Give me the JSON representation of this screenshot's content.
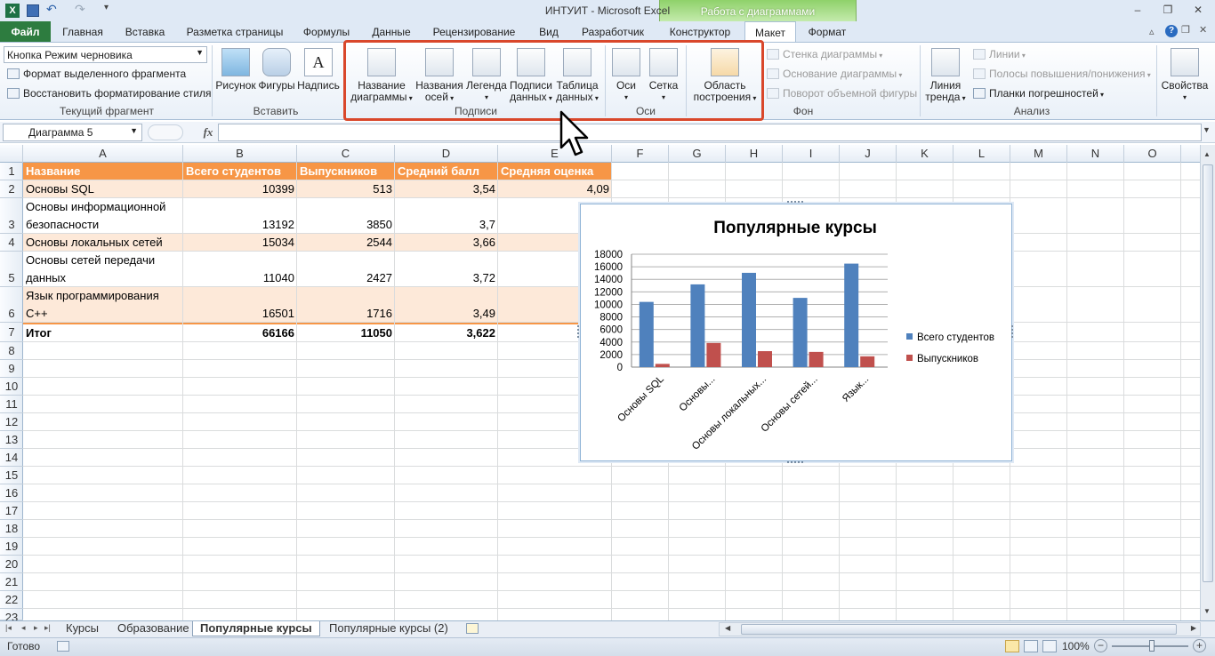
{
  "window": {
    "title": "ИНТУИТ - Microsoft Excel",
    "context_group": "Работа с диаграммами"
  },
  "tabs": [
    "Файл",
    "Главная",
    "Вставка",
    "Разметка страницы",
    "Формулы",
    "Данные",
    "Рецензирование",
    "Вид",
    "Разработчик",
    "Конструктор",
    "Макет",
    "Формат"
  ],
  "ribbon": {
    "current_fragment": {
      "dropdown_value": "Кнопка Режим черновика",
      "format_selection": "Формат выделенного фрагмента",
      "reset_style": "Восстановить форматирование стиля",
      "label": "Текущий фрагмент"
    },
    "insert": {
      "picture": "Рисунок",
      "shapes": "Фигуры",
      "textbox": "Надпись",
      "label": "Вставить"
    },
    "labels": {
      "chart_title_1": "Название",
      "chart_title_2": "диаграммы",
      "axis_titles_1": "Названия",
      "axis_titles_2": "осей",
      "legend": "Легенда",
      "data_labels_1": "Подписи",
      "data_labels_2": "данных",
      "data_table_1": "Таблица",
      "data_table_2": "данных",
      "label": "Подписи"
    },
    "axes": {
      "axes": "Оси",
      "gridlines": "Сетка",
      "label": "Оси"
    },
    "plot_area": {
      "line1": "Область",
      "line2": "построения"
    },
    "background": {
      "chart_wall": "Стенка диаграммы",
      "chart_floor": "Основание диаграммы",
      "rotation": "Поворот объемной фигуры",
      "label": "Фон"
    },
    "analysis": {
      "trendline_1": "Линия",
      "trendline_2": "тренда",
      "lines": "Линии",
      "updown": "Полосы повышения/понижения",
      "error_bars": "Планки погрешностей",
      "label": "Анализ"
    },
    "properties": "Свойства"
  },
  "formula_bar": {
    "name_box": "Диаграмма 5",
    "fx": "fx",
    "formula": ""
  },
  "columns": [
    "A",
    "B",
    "C",
    "D",
    "E",
    "F",
    "G",
    "H",
    "I",
    "J",
    "K",
    "L",
    "M",
    "N",
    "O"
  ],
  "rows": [
    "1",
    "2",
    "3",
    "4",
    "5",
    "6",
    "7",
    "8",
    "9",
    "10",
    "11",
    "12",
    "13",
    "14",
    "15",
    "16",
    "17",
    "18",
    "19",
    "20",
    "21",
    "22",
    "23"
  ],
  "table": {
    "headers": [
      "Название",
      "Всего студентов",
      "Выпускников",
      "Средний балл",
      "Средняя оценка"
    ],
    "r2": {
      "a": "Основы SQL",
      "b": "10399",
      "c": "513",
      "d": "3,54",
      "e": "4,09"
    },
    "r3": {
      "a1": "Основы информационной",
      "a2": "безопасности",
      "b": "13192",
      "c": "3850",
      "d": "3,7"
    },
    "r4": {
      "a": "Основы локальных сетей",
      "b": "15034",
      "c": "2544",
      "d": "3,66"
    },
    "r5": {
      "a1": "Основы сетей передачи",
      "a2": "данных",
      "b": "11040",
      "c": "2427",
      "d": "3,72"
    },
    "r6": {
      "a1": "Язык программирования",
      "a2": "C++",
      "b": "16501",
      "c": "1716",
      "d": "3,49"
    },
    "r7": {
      "a": "Итог",
      "b": "66166",
      "c": "11050",
      "d": "3,622"
    }
  },
  "chart_data": {
    "type": "bar",
    "title": "Популярные курсы",
    "categories": [
      "Основы SQL",
      "Основы...",
      "Основы локальных...",
      "Основы сетей...",
      "Язык..."
    ],
    "series": [
      {
        "name": "Всего студентов",
        "values": [
          10399,
          13192,
          15034,
          11040,
          16501
        ],
        "color": "#4f81bd"
      },
      {
        "name": "Выпускников",
        "values": [
          513,
          3850,
          2544,
          2427,
          1716
        ],
        "color": "#c0504d"
      }
    ],
    "yticks": [
      "0",
      "2000",
      "4000",
      "6000",
      "8000",
      "10000",
      "12000",
      "14000",
      "16000",
      "18000"
    ],
    "ylim": [
      0,
      18000
    ],
    "grid": true,
    "legend_position": "right"
  },
  "sheets": [
    "Курсы",
    "Образование",
    "Популярные курсы",
    "Популярные курсы (2)"
  ],
  "status": {
    "ready": "Готово",
    "zoom": "100%"
  },
  "colors": {
    "header_fill": "#f79646",
    "band_fill": "#fde9d9",
    "highlight": "#d9472b",
    "file_tab": "#2d7c3f"
  }
}
